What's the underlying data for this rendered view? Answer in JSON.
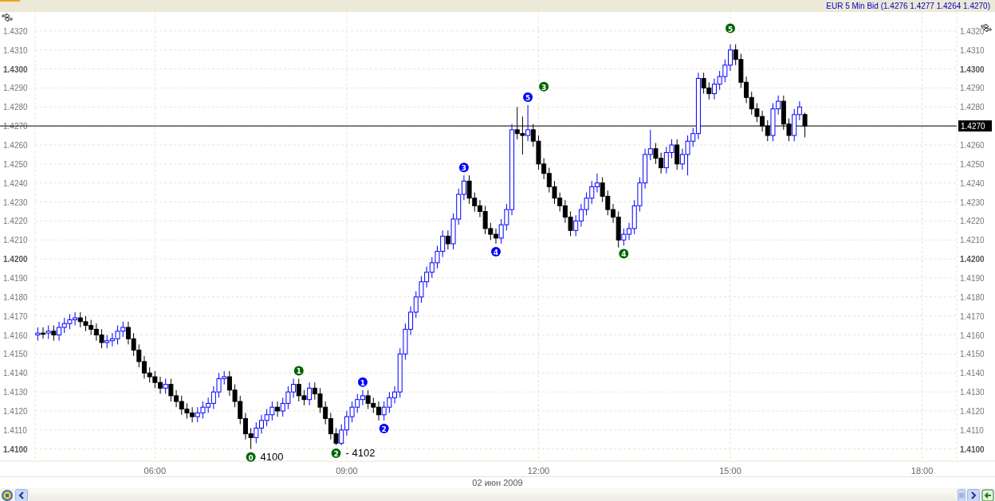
{
  "chart": {
    "date_label": "02 июн 2009",
    "annotation_styles": [
      {
        "kind": "marker",
        "color": "#006400"
      },
      {
        "kind": "text"
      },
      {
        "kind": "marker",
        "color": "#006400"
      },
      {
        "kind": "marker",
        "color": "#006400"
      },
      {
        "kind": "text"
      },
      {
        "kind": "marker",
        "color": "#0000ff"
      },
      {
        "kind": "marker",
        "color": "#0000ff"
      },
      {
        "kind": "marker",
        "color": "#0000ff"
      },
      {
        "kind": "marker",
        "color": "#0000ff"
      },
      {
        "kind": "marker",
        "color": "#0000ff"
      },
      {
        "kind": "marker",
        "color": "#006400"
      },
      {
        "kind": "marker",
        "color": "#006400"
      },
      {
        "kind": "marker",
        "color": "#006400"
      }
    ],
    "chart_data": {
      "type": "candlestick",
      "title": "EUR 5 Min Bid (1.4276 1.4277 1.4264 1.4270)",
      "grid": true,
      "ylim": [
        1.4094,
        1.433
      ],
      "yticks": [
        {
          "value": 1.41,
          "label": "1.4100"
        },
        {
          "value": 1.411,
          "label": "1.4110"
        },
        {
          "value": 1.412,
          "label": "1.4120"
        },
        {
          "value": 1.413,
          "label": "1.4130"
        },
        {
          "value": 1.414,
          "label": "1.4140"
        },
        {
          "value": 1.415,
          "label": "1.4150"
        },
        {
          "value": 1.416,
          "label": "1.4160"
        },
        {
          "value": 1.417,
          "label": "1.4170"
        },
        {
          "value": 1.418,
          "label": "1.4180"
        },
        {
          "value": 1.419,
          "label": "1.4190"
        },
        {
          "value": 1.42,
          "label": "1.4200"
        },
        {
          "value": 1.421,
          "label": "1.4210"
        },
        {
          "value": 1.422,
          "label": "1.4220"
        },
        {
          "value": 1.423,
          "label": "1.4230"
        },
        {
          "value": 1.424,
          "label": "1.4240"
        },
        {
          "value": 1.425,
          "label": "1.4250"
        },
        {
          "value": 1.426,
          "label": "1.4260"
        },
        {
          "value": 1.427,
          "label": "1.4270"
        },
        {
          "value": 1.428,
          "label": "1.4280"
        },
        {
          "value": 1.429,
          "label": "1.4290"
        },
        {
          "value": 1.43,
          "label": "1.4300"
        },
        {
          "value": 1.431,
          "label": "1.4310"
        },
        {
          "value": 1.432,
          "label": "1.4320"
        }
      ],
      "categories": [
        null,
        null,
        null,
        null,
        null,
        null,
        null,
        null,
        null,
        null,
        null,
        null,
        null,
        null,
        null,
        null,
        null,
        null,
        null,
        null,
        null,
        null,
        "06:00",
        null,
        null,
        null,
        null,
        null,
        null,
        null,
        null,
        null,
        null,
        null,
        null,
        null,
        null,
        null,
        null,
        null,
        null,
        null,
        null,
        null,
        null,
        null,
        null,
        null,
        null,
        null,
        null,
        null,
        null,
        null,
        null,
        null,
        null,
        null,
        "09:00",
        null,
        null,
        null,
        null,
        null,
        null,
        null,
        null,
        null,
        null,
        null,
        null,
        null,
        null,
        null,
        null,
        null,
        null,
        null,
        null,
        null,
        null,
        null,
        null,
        null,
        null,
        null,
        null,
        null,
        null,
        null,
        null,
        null,
        null,
        null,
        "12:00",
        null,
        null,
        null,
        null,
        null,
        null,
        null,
        null,
        null,
        null,
        null,
        null,
        null,
        null,
        null,
        null,
        null,
        null,
        null,
        null,
        null,
        null,
        null,
        null,
        null,
        null,
        null,
        null,
        null,
        null,
        null,
        null,
        null,
        null,
        null,
        "15:00",
        null,
        null,
        null,
        null,
        null,
        null,
        null,
        null,
        null,
        null,
        null,
        null,
        null,
        null,
        null,
        null,
        null,
        null,
        null,
        null,
        null,
        null,
        null,
        null,
        null,
        null,
        null,
        null,
        null,
        null,
        null,
        null,
        null,
        null,
        null,
        "18:00",
        null,
        null,
        null,
        null,
        null,
        null
      ],
      "ohlc": [
        [
          1.416,
          1.4164,
          1.4157,
          1.4161
        ],
        [
          1.4161,
          1.4164,
          1.4158,
          1.4161
        ],
        [
          1.4161,
          1.4165,
          1.4158,
          1.4162
        ],
        [
          1.4162,
          1.4165,
          1.4157,
          1.416
        ],
        [
          1.416,
          1.4167,
          1.4157,
          1.4164
        ],
        [
          1.4164,
          1.4169,
          1.4161,
          1.4166
        ],
        [
          1.4166,
          1.4171,
          1.4163,
          1.4168
        ],
        [
          1.4168,
          1.4172,
          1.4165,
          1.4169
        ],
        [
          1.4169,
          1.4172,
          1.4164,
          1.4167
        ],
        [
          1.4167,
          1.417,
          1.4162,
          1.4165
        ],
        [
          1.4165,
          1.4168,
          1.416,
          1.4163
        ],
        [
          1.4163,
          1.4166,
          1.4157,
          1.416
        ],
        [
          1.416,
          1.4163,
          1.4153,
          1.4156
        ],
        [
          1.4156,
          1.416,
          1.4153,
          1.4157
        ],
        [
          1.4157,
          1.4161,
          1.4154,
          1.4158
        ],
        [
          1.4158,
          1.4165,
          1.4155,
          1.4162
        ],
        [
          1.4162,
          1.4167,
          1.4159,
          1.4164
        ],
        [
          1.4164,
          1.4167,
          1.4155,
          1.4158
        ],
        [
          1.4158,
          1.4161,
          1.4149,
          1.4152
        ],
        [
          1.4152,
          1.4155,
          1.4143,
          1.4146
        ],
        [
          1.4146,
          1.4149,
          1.4137,
          1.414
        ],
        [
          1.414,
          1.4143,
          1.4135,
          1.4138
        ],
        [
          1.4138,
          1.4141,
          1.4132,
          1.4135
        ],
        [
          1.4135,
          1.4138,
          1.4129,
          1.4132
        ],
        [
          1.4132,
          1.4137,
          1.4129,
          1.4134
        ],
        [
          1.4134,
          1.4137,
          1.4125,
          1.4128
        ],
        [
          1.4128,
          1.4131,
          1.4122,
          1.4125
        ],
        [
          1.4125,
          1.4128,
          1.4118,
          1.4121
        ],
        [
          1.4121,
          1.4124,
          1.4116,
          1.4119
        ],
        [
          1.4119,
          1.4122,
          1.4114,
          1.4117
        ],
        [
          1.4117,
          1.4122,
          1.4114,
          1.4119
        ],
        [
          1.4119,
          1.4125,
          1.4116,
          1.4122
        ],
        [
          1.4122,
          1.4127,
          1.4119,
          1.4124
        ],
        [
          1.4124,
          1.4133,
          1.4121,
          1.413
        ],
        [
          1.413,
          1.414,
          1.4127,
          1.4137
        ],
        [
          1.4137,
          1.4141,
          1.4134,
          1.4138
        ],
        [
          1.4138,
          1.4141,
          1.4128,
          1.4131
        ],
        [
          1.4131,
          1.4134,
          1.4122,
          1.4125
        ],
        [
          1.4125,
          1.4128,
          1.4113,
          1.4116
        ],
        [
          1.4116,
          1.4119,
          1.4105,
          1.4108
        ],
        [
          1.4108,
          1.4111,
          1.41,
          1.4106
        ],
        [
          1.4106,
          1.4114,
          1.4103,
          1.4111
        ],
        [
          1.4111,
          1.4118,
          1.4108,
          1.4115
        ],
        [
          1.4115,
          1.4121,
          1.4112,
          1.4118
        ],
        [
          1.4118,
          1.4125,
          1.4115,
          1.4122
        ],
        [
          1.4122,
          1.4125,
          1.4117,
          1.412
        ],
        [
          1.412,
          1.4127,
          1.4117,
          1.4124
        ],
        [
          1.4124,
          1.4133,
          1.4121,
          1.413
        ],
        [
          1.413,
          1.4137,
          1.4127,
          1.4134
        ],
        [
          1.4134,
          1.4137,
          1.4125,
          1.4128
        ],
        [
          1.4128,
          1.4131,
          1.4123,
          1.4126
        ],
        [
          1.4126,
          1.4135,
          1.4123,
          1.4132
        ],
        [
          1.4132,
          1.4135,
          1.4126,
          1.4129
        ],
        [
          1.4129,
          1.4132,
          1.4119,
          1.4122
        ],
        [
          1.4122,
          1.4125,
          1.4113,
          1.4116
        ],
        [
          1.4116,
          1.4119,
          1.4105,
          1.4108
        ],
        [
          1.4108,
          1.4111,
          1.4102,
          1.4103
        ],
        [
          1.4103,
          1.4113,
          1.4102,
          1.411
        ],
        [
          1.411,
          1.412,
          1.4107,
          1.4117
        ],
        [
          1.4117,
          1.4125,
          1.4114,
          1.4122
        ],
        [
          1.4122,
          1.4129,
          1.4119,
          1.4126
        ],
        [
          1.4126,
          1.4131,
          1.4123,
          1.4128
        ],
        [
          1.4128,
          1.4131,
          1.4121,
          1.4124
        ],
        [
          1.4124,
          1.4127,
          1.4119,
          1.4122
        ],
        [
          1.4122,
          1.4125,
          1.4115,
          1.4118
        ],
        [
          1.4118,
          1.4125,
          1.4115,
          1.4122
        ],
        [
          1.4122,
          1.413,
          1.4119,
          1.4127
        ],
        [
          1.4127,
          1.4133,
          1.4124,
          1.413
        ],
        [
          1.413,
          1.4153,
          1.4127,
          1.415
        ],
        [
          1.415,
          1.4166,
          1.4147,
          1.4163
        ],
        [
          1.4163,
          1.4175,
          1.416,
          1.4172
        ],
        [
          1.4172,
          1.4183,
          1.4169,
          1.418
        ],
        [
          1.418,
          1.4191,
          1.4177,
          1.4188
        ],
        [
          1.4188,
          1.4196,
          1.4185,
          1.4193
        ],
        [
          1.4193,
          1.4201,
          1.419,
          1.4198
        ],
        [
          1.4198,
          1.4207,
          1.4195,
          1.4204
        ],
        [
          1.4204,
          1.4215,
          1.4201,
          1.4212
        ],
        [
          1.4212,
          1.4215,
          1.4205,
          1.4208
        ],
        [
          1.4208,
          1.4224,
          1.4205,
          1.4221
        ],
        [
          1.4221,
          1.4237,
          1.4218,
          1.4234
        ],
        [
          1.4234,
          1.4244,
          1.4231,
          1.4241
        ],
        [
          1.4241,
          1.4244,
          1.4229,
          1.4232
        ],
        [
          1.4232,
          1.4235,
          1.4225,
          1.4228
        ],
        [
          1.4228,
          1.4231,
          1.4222,
          1.4225
        ],
        [
          1.4225,
          1.4228,
          1.4213,
          1.4216
        ],
        [
          1.4216,
          1.4219,
          1.421,
          1.4213
        ],
        [
          1.4213,
          1.4216,
          1.4208,
          1.4211
        ],
        [
          1.4211,
          1.4221,
          1.4208,
          1.4218
        ],
        [
          1.4218,
          1.4229,
          1.4215,
          1.4226
        ],
        [
          1.4226,
          1.4271,
          1.4223,
          1.4268
        ],
        [
          1.4268,
          1.428,
          1.4263,
          1.4266
        ],
        [
          1.4266,
          1.4275,
          1.4255,
          1.4265
        ],
        [
          1.4265,
          1.4281,
          1.4262,
          1.4268
        ],
        [
          1.4268,
          1.4271,
          1.4259,
          1.4262
        ],
        [
          1.4262,
          1.4265,
          1.4247,
          1.425
        ],
        [
          1.425,
          1.4253,
          1.4242,
          1.4245
        ],
        [
          1.4245,
          1.4248,
          1.4235,
          1.4238
        ],
        [
          1.4238,
          1.4241,
          1.4229,
          1.4232
        ],
        [
          1.4232,
          1.4235,
          1.4225,
          1.4228
        ],
        [
          1.4228,
          1.4231,
          1.4219,
          1.4222
        ],
        [
          1.4222,
          1.4225,
          1.4212,
          1.4215
        ],
        [
          1.4215,
          1.4223,
          1.4212,
          1.422
        ],
        [
          1.422,
          1.4229,
          1.4217,
          1.4226
        ],
        [
          1.4226,
          1.4235,
          1.4223,
          1.4232
        ],
        [
          1.4232,
          1.4241,
          1.4229,
          1.4238
        ],
        [
          1.4238,
          1.4245,
          1.4235,
          1.424
        ],
        [
          1.424,
          1.4243,
          1.423,
          1.4233
        ],
        [
          1.4233,
          1.4236,
          1.4223,
          1.4226
        ],
        [
          1.4226,
          1.4229,
          1.4219,
          1.4222
        ],
        [
          1.4222,
          1.4225,
          1.4206,
          1.421
        ],
        [
          1.421,
          1.4216,
          1.4207,
          1.4213
        ],
        [
          1.4213,
          1.4219,
          1.421,
          1.4216
        ],
        [
          1.4216,
          1.4231,
          1.4213,
          1.4228
        ],
        [
          1.4228,
          1.4243,
          1.4225,
          1.424
        ],
        [
          1.424,
          1.4258,
          1.4237,
          1.4255
        ],
        [
          1.4255,
          1.4268,
          1.4252,
          1.4258
        ],
        [
          1.4258,
          1.4261,
          1.425,
          1.4253
        ],
        [
          1.4253,
          1.4256,
          1.4245,
          1.4248
        ],
        [
          1.4248,
          1.4259,
          1.4245,
          1.4256
        ],
        [
          1.4256,
          1.4263,
          1.4253,
          1.426
        ],
        [
          1.426,
          1.4263,
          1.4247,
          1.425
        ],
        [
          1.425,
          1.4258,
          1.4247,
          1.4255
        ],
        [
          1.4255,
          1.4265,
          1.4244,
          1.4262
        ],
        [
          1.4262,
          1.4269,
          1.4259,
          1.4266
        ],
        [
          1.4266,
          1.4298,
          1.4263,
          1.4295
        ],
        [
          1.4295,
          1.4298,
          1.4287,
          1.429
        ],
        [
          1.429,
          1.4293,
          1.4284,
          1.4287
        ],
        [
          1.4287,
          1.4295,
          1.4284,
          1.4292
        ],
        [
          1.4292,
          1.4299,
          1.4289,
          1.4296
        ],
        [
          1.4296,
          1.4305,
          1.4293,
          1.4302
        ],
        [
          1.4302,
          1.4313,
          1.4299,
          1.431
        ],
        [
          1.431,
          1.4313,
          1.4302,
          1.4305
        ],
        [
          1.4305,
          1.4308,
          1.429,
          1.4293
        ],
        [
          1.4293,
          1.4296,
          1.4282,
          1.4285
        ],
        [
          1.4285,
          1.4288,
          1.4276,
          1.4279
        ],
        [
          1.4279,
          1.4282,
          1.4272,
          1.4275
        ],
        [
          1.4275,
          1.4278,
          1.4267,
          1.427
        ],
        [
          1.427,
          1.4273,
          1.4262,
          1.4265
        ],
        [
          1.4265,
          1.4282,
          1.4262,
          1.4279
        ],
        [
          1.4279,
          1.4286,
          1.4276,
          1.4283
        ],
        [
          1.4283,
          1.4286,
          1.4268,
          1.4271
        ],
        [
          1.4271,
          1.4274,
          1.4262,
          1.4265
        ],
        [
          1.4265,
          1.4279,
          1.4262,
          1.4276
        ],
        [
          1.4276,
          1.4283,
          1.4273,
          1.428
        ],
        [
          1.4276,
          1.4277,
          1.4264,
          1.427
        ],
        null,
        null,
        null,
        null,
        null,
        null,
        null,
        null,
        null,
        null,
        null,
        null,
        null,
        null,
        null,
        null,
        null,
        null,
        null,
        null,
        null,
        null,
        null,
        null,
        null,
        null,
        null,
        null
      ],
      "ref_lines": [
        {
          "axis": "y",
          "value": 1.427,
          "label": "1.4270"
        }
      ],
      "annotations": [
        "0",
        "4100",
        "1",
        "2",
        "- 4102",
        "1",
        "2",
        "3",
        "4",
        "5",
        "3",
        "4",
        "5"
      ]
    }
  }
}
